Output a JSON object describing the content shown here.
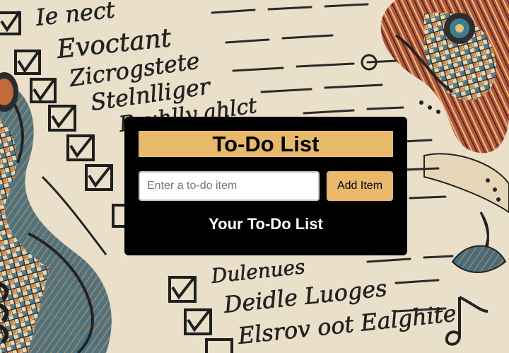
{
  "app": {
    "title": "To-Do List",
    "input_placeholder": "Enter a to-do item",
    "input_value": "",
    "add_button_label": "Add Item",
    "list_heading": "Your To-Do List",
    "items": []
  },
  "colors": {
    "accent": "#e8b96a",
    "panel": "#000000",
    "background_paper": "#e9ddc6"
  },
  "background": {
    "description_icon": "doodle-notebook-background",
    "handwriting_lines": [
      "Ie nect",
      "Evoctant",
      "Zicrogstete",
      "Stelnlliger",
      "Bruhlly ahlct",
      "Dulenues",
      "Deidle Luoges",
      "Elsrov oot Ealghite"
    ]
  }
}
